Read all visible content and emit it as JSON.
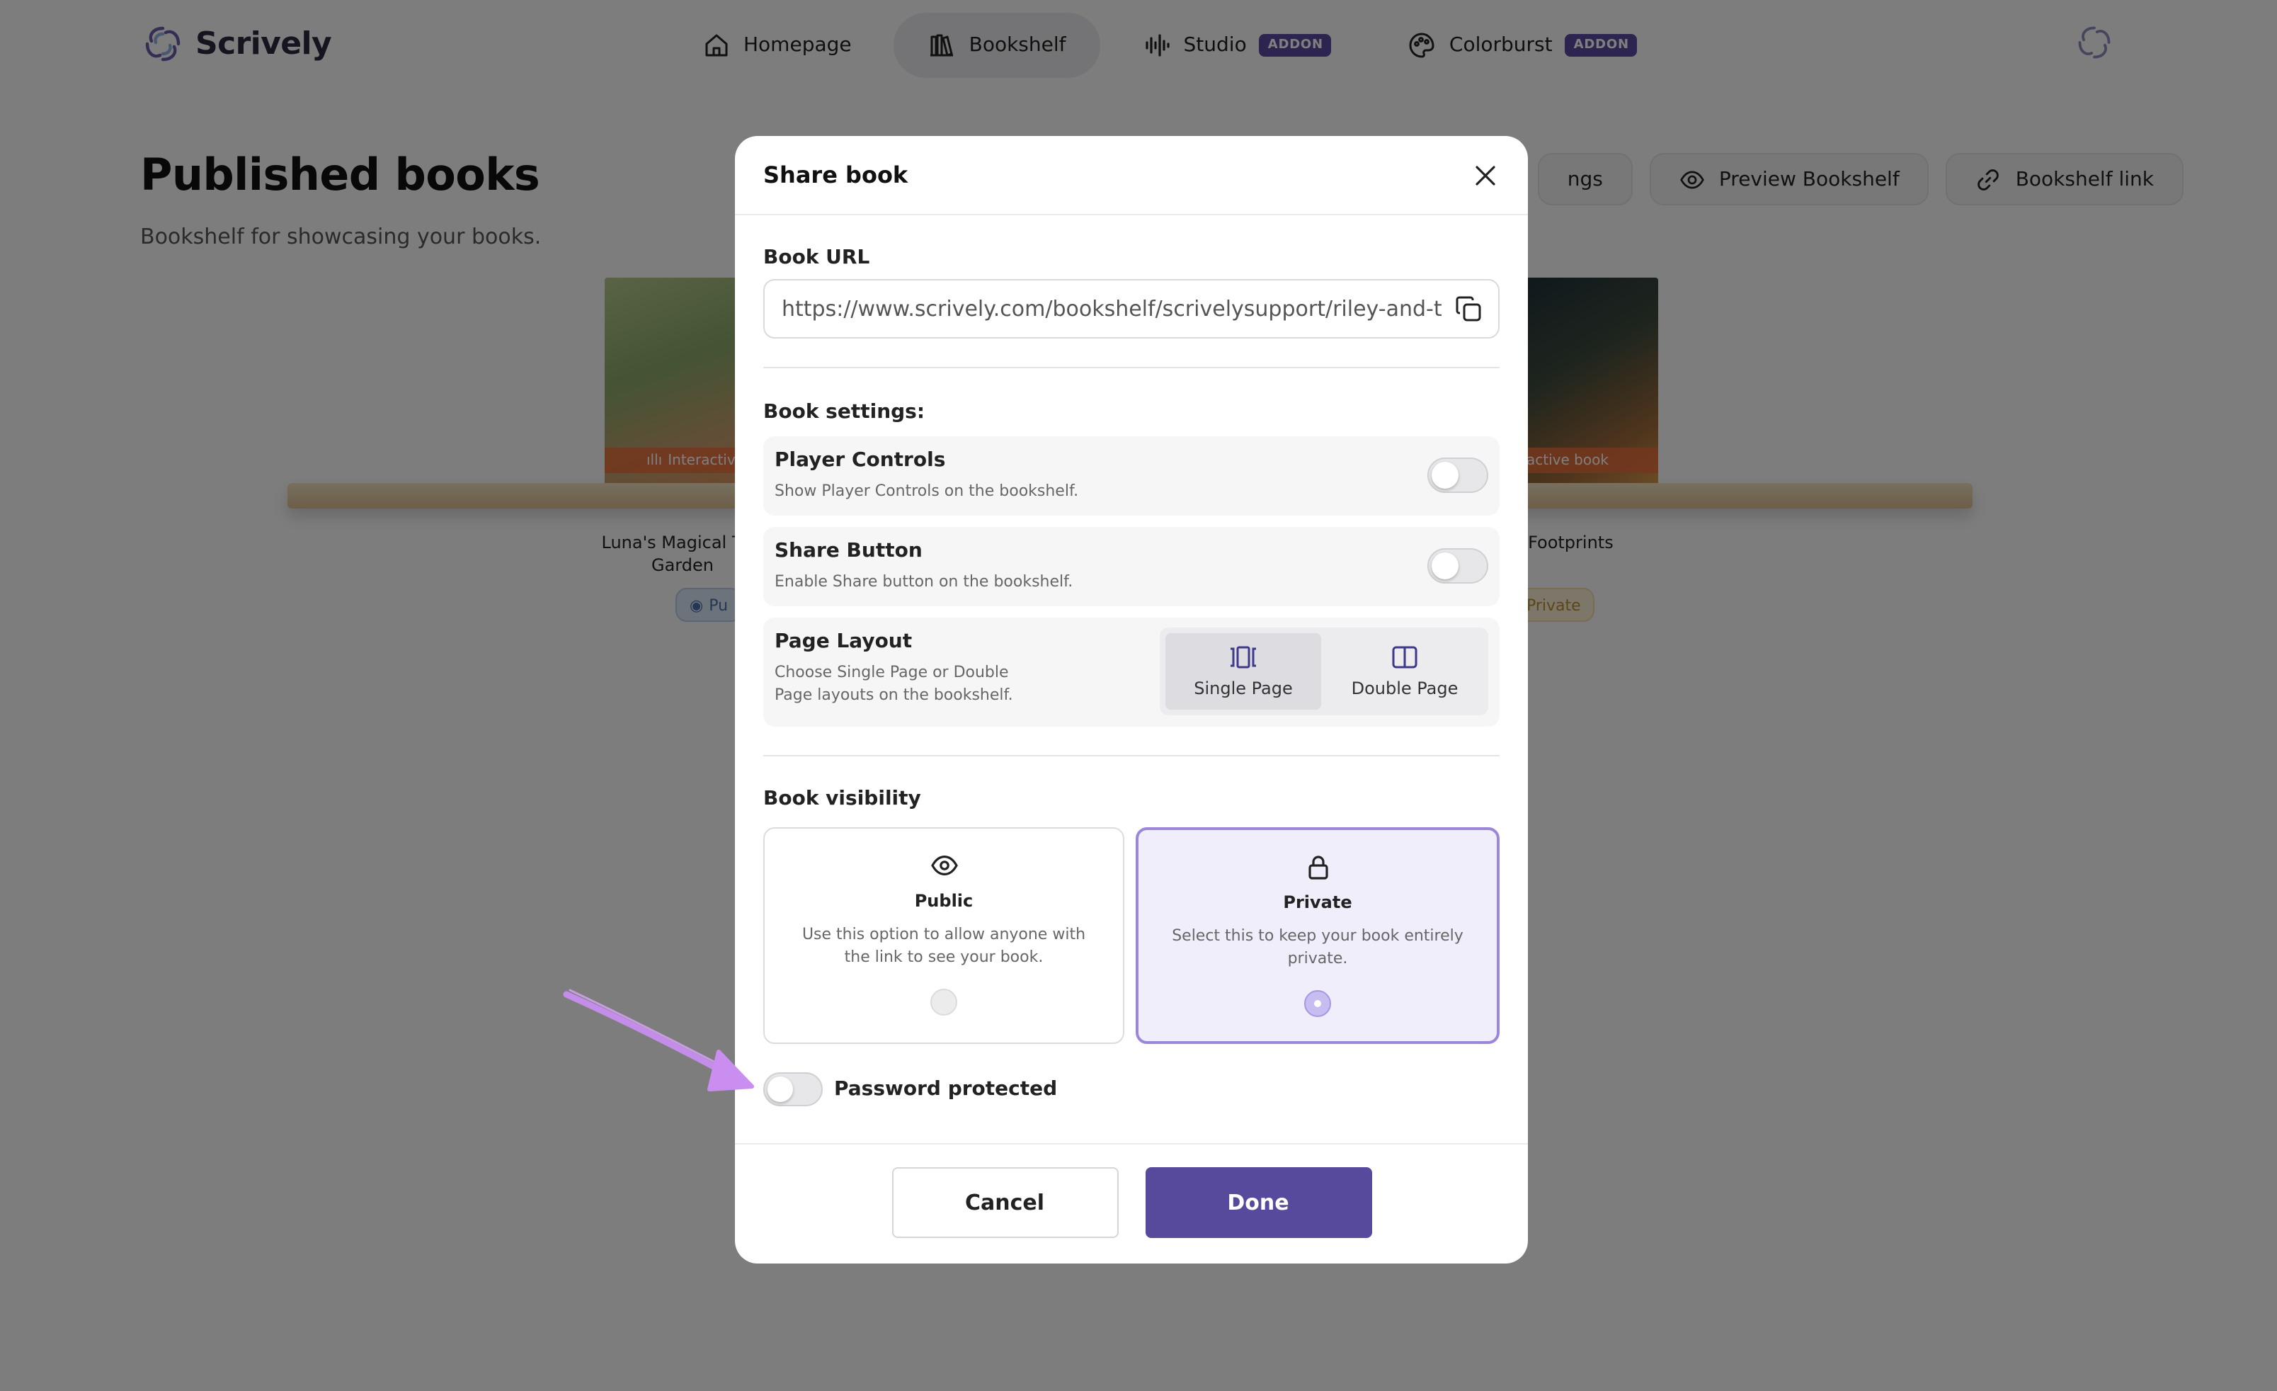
{
  "app": {
    "name": "Scrively",
    "accent_color": "#574a9c",
    "logo_icon": "scrively-swirl-icon"
  },
  "nav": {
    "items": [
      {
        "label": "Homepage",
        "icon": "home-icon",
        "active": false
      },
      {
        "label": "Bookshelf",
        "icon": "bookshelf-icon",
        "active": true
      },
      {
        "label": "Studio",
        "icon": "audio-wave-icon",
        "badge": "ADDON",
        "active": false
      },
      {
        "label": "Colorburst",
        "icon": "palette-icon",
        "badge": "ADDON",
        "active": false
      }
    ]
  },
  "page": {
    "title": "Published books",
    "subtitle": "Bookshelf for showcasing your books.",
    "header_buttons": [
      {
        "label": "ngs",
        "icon": "settings-icon"
      },
      {
        "label": "Preview Bookshelf",
        "icon": "eye-icon"
      },
      {
        "label": "Bookshelf link",
        "icon": "link-icon"
      }
    ]
  },
  "books": [
    {
      "title": "Luna's Magical The Garden",
      "tag": "Interactive",
      "status": "Pu"
    },
    {
      "title": "ng Footprints",
      "tag": "active book",
      "status": "Private"
    }
  ],
  "modal": {
    "title": "Share book",
    "url_label": "Book URL",
    "url_value": "https://www.scrively.com/bookshelf/scrivelysupport/riley-and-the-m",
    "settings_label": "Book settings:",
    "player_controls": {
      "title": "Player Controls",
      "desc": "Show Player Controls on the bookshelf.",
      "enabled": false
    },
    "share_button": {
      "title": "Share Button",
      "desc": "Enable Share button on the bookshelf.",
      "enabled": false
    },
    "page_layout": {
      "title": "Page Layout",
      "desc": "Choose Single Page or Double Page layouts on the bookshelf.",
      "options": [
        "Single Page",
        "Double Page"
      ],
      "selected": "Single Page"
    },
    "visibility": {
      "label": "Book visibility",
      "public": {
        "title": "Public",
        "desc": "Use this option to allow anyone with the link to see your book.",
        "icon": "eye-icon"
      },
      "private": {
        "title": "Private",
        "desc": "Select this to keep your book entirely private.",
        "icon": "lock-icon"
      },
      "selected": "Private"
    },
    "password": {
      "label": "Password protected",
      "enabled": false
    },
    "cancel_label": "Cancel",
    "done_label": "Done"
  },
  "annotation": {
    "color": "#c98ef0",
    "icon": "arrow-annotation"
  }
}
